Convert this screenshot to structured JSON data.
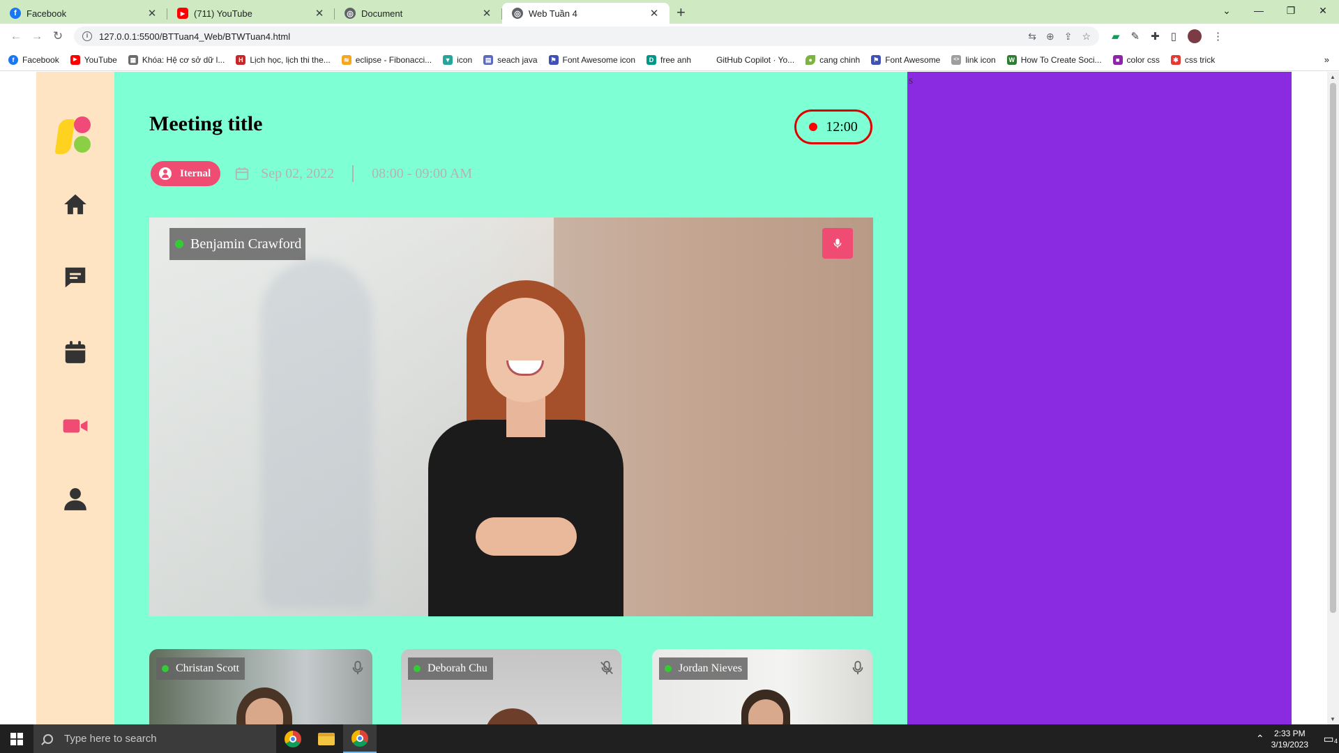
{
  "browser": {
    "tabs": [
      {
        "label": "Facebook",
        "favicon": "facebook-icon",
        "color": "#1877f2"
      },
      {
        "label": "(711) YouTube",
        "favicon": "youtube-icon",
        "color": "#ff0000"
      },
      {
        "label": "Document",
        "favicon": "globe-icon",
        "color": "#5f6368"
      },
      {
        "label": "Web Tuần 4",
        "favicon": "globe-icon",
        "color": "#5f6368",
        "active": true
      }
    ],
    "new_tab": "+",
    "url": "127.0.0.1:5500/BTTuan4_Web/BTWTuan4.html",
    "bookmarks": [
      {
        "label": "Facebook",
        "color": "#1877f2",
        "glyph": "f"
      },
      {
        "label": "YouTube",
        "color": "#ff0000",
        "glyph": "▶"
      },
      {
        "label": "Khóa: Hệ cơ sở dữ l...",
        "color": "#6b6b6b",
        "glyph": "▦"
      },
      {
        "label": "Lịch học, lịch thi the...",
        "color": "#c62828",
        "glyph": "H"
      },
      {
        "label": "eclipse - Fibonacci...",
        "color": "#f5a623",
        "glyph": "≋"
      },
      {
        "label": "icon",
        "color": "#26a69a",
        "glyph": "▼"
      },
      {
        "label": "seach java",
        "color": "#5c6bc0",
        "glyph": "▤"
      },
      {
        "label": "Font Awesome icon",
        "color": "#3f51b5",
        "glyph": "⚑"
      },
      {
        "label": "free anh",
        "color": "#009688",
        "glyph": "D"
      },
      {
        "label": "GitHub Copilot · Yo...",
        "color": "#ffffff",
        "glyph": ""
      },
      {
        "label": "cang chinh",
        "color": "#7cb342",
        "glyph": "●"
      },
      {
        "label": "Font Awesome",
        "color": "#3f51b5",
        "glyph": "⚑"
      },
      {
        "label": "link icon",
        "color": "#9e9e9e",
        "glyph": "<>"
      },
      {
        "label": "How To Create Soci...",
        "color": "#2e7d32",
        "glyph": "W"
      },
      {
        "label": "color css",
        "color": "#8e24aa",
        "glyph": "■"
      },
      {
        "label": "css trick",
        "color": "#e53935",
        "glyph": "✱"
      }
    ],
    "bookmarks_more": "»"
  },
  "page": {
    "title": "Meeting title",
    "timer": "12:00",
    "badge": "Iternal",
    "date": "Sep 02, 2022",
    "time_range": "08:00 - 09:00 AM",
    "stray_text": "s",
    "main_speaker": "Benjamin Crawford",
    "participants": [
      {
        "name": "Christan Scott",
        "mic": "mic-icon"
      },
      {
        "name": "Deborah Chu",
        "mic": "mic-muted-icon"
      },
      {
        "name": "Jordan Nieves",
        "mic": "mic-icon"
      }
    ],
    "nav": [
      "home-icon",
      "chat-icon",
      "calendar-icon",
      "video-icon",
      "user-icon"
    ],
    "colors": {
      "sidebar": "#ffe4c4",
      "main": "#7fffd4",
      "right_panel": "#8a2be2",
      "accent": "#ef4b73"
    }
  },
  "taskbar": {
    "search_placeholder": "Type here to search",
    "time": "2:33 PM",
    "date": "3/19/2023",
    "notifications": "4"
  }
}
